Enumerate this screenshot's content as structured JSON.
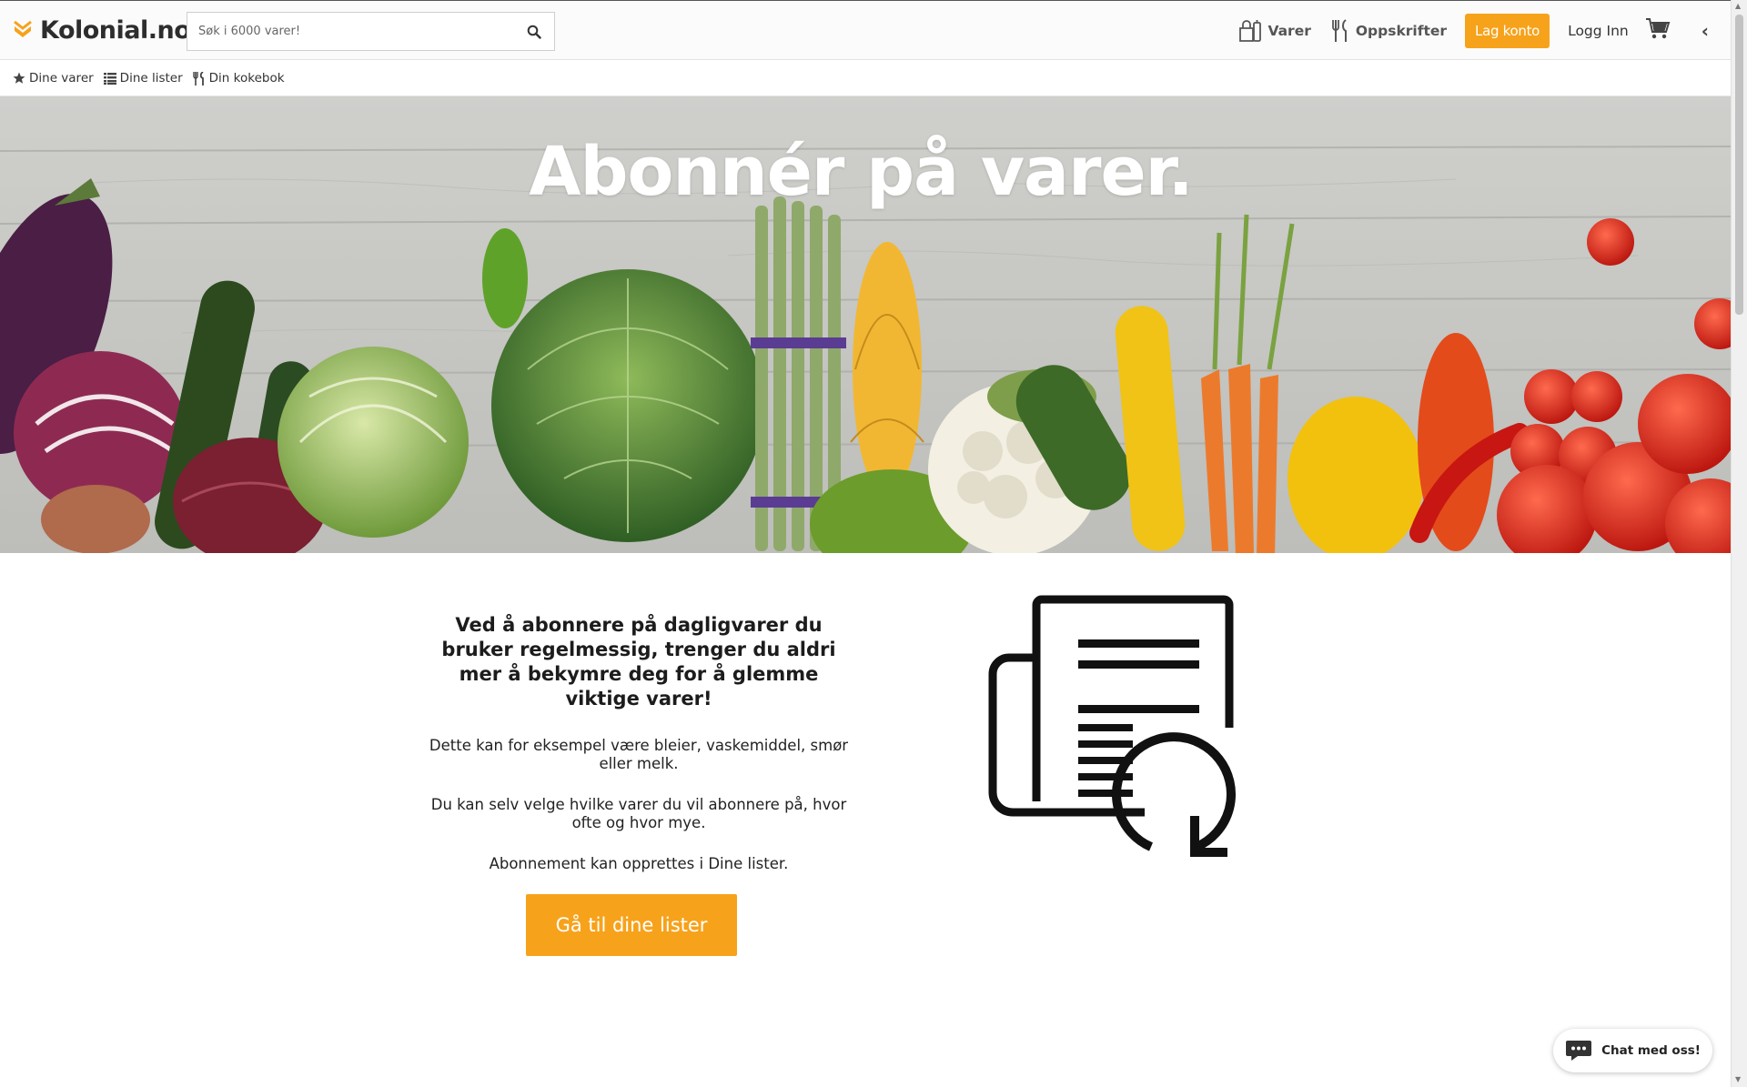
{
  "header": {
    "logo_text": "Kolonial.no",
    "search_placeholder": "Søk i 6000 varer!",
    "nav": {
      "varer": "Varer",
      "oppskrifter": "Oppskrifter",
      "lag_konto": "Lag konto",
      "logg_inn": "Logg Inn"
    }
  },
  "subnav": {
    "items": [
      {
        "label": "Dine varer",
        "icon": "star-icon"
      },
      {
        "label": "Dine lister",
        "icon": "list-icon"
      },
      {
        "label": "Din kokebok",
        "icon": "cutlery-icon"
      }
    ]
  },
  "hero": {
    "title": "Abonnér på varer."
  },
  "content": {
    "lead": "Ved å abonnere på dagligvarer du bruker regelmessig, trenger du aldri mer å bekymre deg for å glemme viktige varer!",
    "para1": "Dette kan for eksempel være bleier, vaskemiddel, smør eller melk.",
    "para2": "Du kan selv velge hvilke varer du vil abonnere på, hvor ofte og hvor mye.",
    "para3": "Abonnement kan opprettes i Dine lister.",
    "cta": "Gå til dine lister"
  },
  "chat": {
    "label": "Chat med oss!"
  },
  "colors": {
    "accent": "#f7a21b",
    "text": "#222222"
  }
}
